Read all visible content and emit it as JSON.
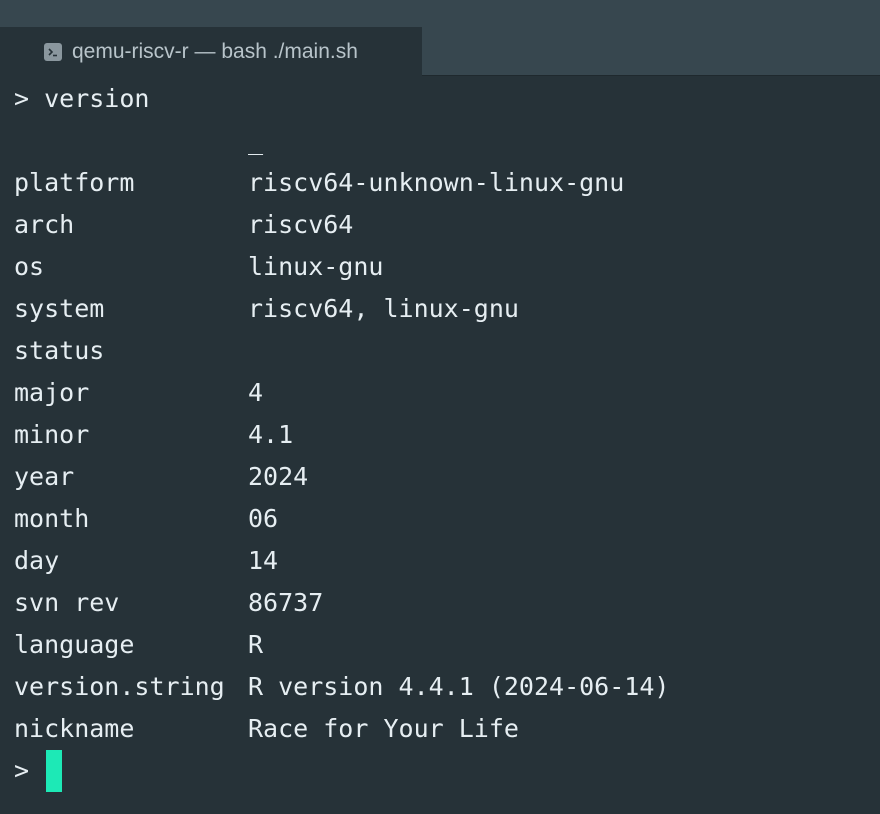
{
  "window": {
    "tab_title": "qemu-riscv-r — bash ./main.sh",
    "tab_icon": "terminal-icon"
  },
  "terminal": {
    "command_line": "> version",
    "separator": "_",
    "rows": [
      {
        "key": "platform",
        "value": "riscv64-unknown-linux-gnu"
      },
      {
        "key": "arch",
        "value": "riscv64"
      },
      {
        "key": "os",
        "value": "linux-gnu"
      },
      {
        "key": "system",
        "value": "riscv64, linux-gnu"
      },
      {
        "key": "status",
        "value": ""
      },
      {
        "key": "major",
        "value": "4"
      },
      {
        "key": "minor",
        "value": "4.1"
      },
      {
        "key": "year",
        "value": "2024"
      },
      {
        "key": "month",
        "value": "06"
      },
      {
        "key": "day",
        "value": "14"
      },
      {
        "key": "svn rev",
        "value": "86737"
      },
      {
        "key": "language",
        "value": "R"
      },
      {
        "key": "version.string",
        "value": "R version 4.4.1 (2024-06-14)"
      },
      {
        "key": "nickname",
        "value": "Race for Your Life"
      }
    ],
    "prompt": ">"
  },
  "colors": {
    "background": "#263238",
    "tabbar": "#37474f",
    "text": "#e6eef2",
    "cursor": "#1de9b6"
  }
}
